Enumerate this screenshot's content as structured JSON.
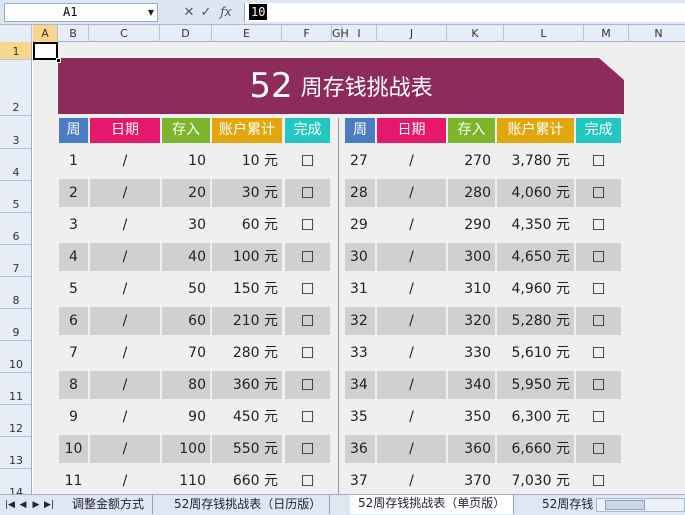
{
  "formula_bar": {
    "name_box": "A1",
    "dropdown": "▼",
    "cancel": "✕",
    "enter": "✓",
    "fx": "ƒx",
    "value": "10"
  },
  "columns": [
    "A",
    "B",
    "C",
    "D",
    "E",
    "F",
    "GH",
    "I",
    "J",
    "K",
    "L",
    "M",
    "N"
  ],
  "rows": [
    "1",
    "2",
    "3",
    "4",
    "5",
    "6",
    "7",
    "8",
    "9",
    "10",
    "11",
    "12",
    "13",
    "14"
  ],
  "title": {
    "number": "52",
    "text": "周存钱挑战表"
  },
  "headers": {
    "week": "周",
    "date": "日期",
    "deposit": "存入",
    "cumulative": "账户累计",
    "done": "完成"
  },
  "left_rows": [
    {
      "week": "1",
      "date": "/",
      "deposit": "10",
      "total": "10 元",
      "done": "☐"
    },
    {
      "week": "2",
      "date": "/",
      "deposit": "20",
      "total": "30 元",
      "done": "☐"
    },
    {
      "week": "3",
      "date": "/",
      "deposit": "30",
      "total": "60 元",
      "done": "☐"
    },
    {
      "week": "4",
      "date": "/",
      "deposit": "40",
      "total": "100 元",
      "done": "☐"
    },
    {
      "week": "5",
      "date": "/",
      "deposit": "50",
      "total": "150 元",
      "done": "☐"
    },
    {
      "week": "6",
      "date": "/",
      "deposit": "60",
      "total": "210 元",
      "done": "☐"
    },
    {
      "week": "7",
      "date": "/",
      "deposit": "70",
      "total": "280 元",
      "done": "☐"
    },
    {
      "week": "8",
      "date": "/",
      "deposit": "80",
      "total": "360 元",
      "done": "☐"
    },
    {
      "week": "9",
      "date": "/",
      "deposit": "90",
      "total": "450 元",
      "done": "☐"
    },
    {
      "week": "10",
      "date": "/",
      "deposit": "100",
      "total": "550 元",
      "done": "☐"
    },
    {
      "week": "11",
      "date": "/",
      "deposit": "110",
      "total": "660 元",
      "done": "☐"
    }
  ],
  "right_rows": [
    {
      "week": "27",
      "date": "/",
      "deposit": "270",
      "total": "3,780 元",
      "done": "☐"
    },
    {
      "week": "28",
      "date": "/",
      "deposit": "280",
      "total": "4,060 元",
      "done": "☐"
    },
    {
      "week": "29",
      "date": "/",
      "deposit": "290",
      "total": "4,350 元",
      "done": "☐"
    },
    {
      "week": "30",
      "date": "/",
      "deposit": "300",
      "total": "4,650 元",
      "done": "☐"
    },
    {
      "week": "31",
      "date": "/",
      "deposit": "310",
      "total": "4,960 元",
      "done": "☐"
    },
    {
      "week": "32",
      "date": "/",
      "deposit": "320",
      "total": "5,280 元",
      "done": "☐"
    },
    {
      "week": "33",
      "date": "/",
      "deposit": "330",
      "total": "5,610 元",
      "done": "☐"
    },
    {
      "week": "34",
      "date": "/",
      "deposit": "340",
      "total": "5,950 元",
      "done": "☐"
    },
    {
      "week": "35",
      "date": "/",
      "deposit": "350",
      "total": "6,300 元",
      "done": "☐"
    },
    {
      "week": "36",
      "date": "/",
      "deposit": "360",
      "total": "6,660 元",
      "done": "☐"
    },
    {
      "week": "37",
      "date": "/",
      "deposit": "370",
      "total": "7,030 元",
      "done": "☐"
    }
  ],
  "tabs": [
    "调整金额方式",
    "52周存钱挑战表（日历版）",
    "52周存钱挑战表（单页版）",
    "52周存钱"
  ],
  "active_tab": 2,
  "nav": [
    "|◀",
    "◀",
    "▶",
    "▶|"
  ]
}
